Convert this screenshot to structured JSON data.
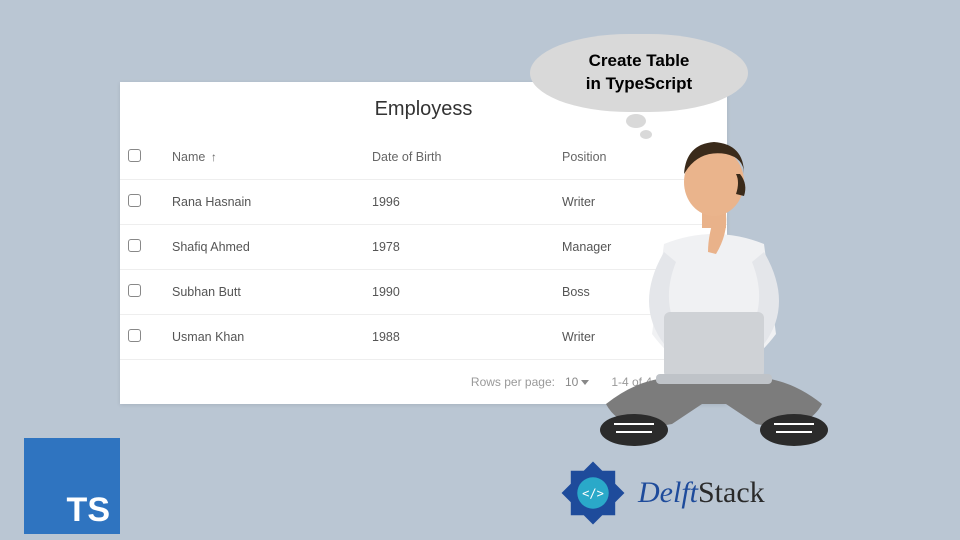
{
  "thought": {
    "line1": "Create Table",
    "line2": "in TypeScript"
  },
  "table": {
    "title": "Employess",
    "columns": {
      "name": "Name",
      "dob": "Date of Birth",
      "position": "Position"
    },
    "sort_dir": "asc",
    "rows": [
      {
        "name": "Rana Hasnain",
        "dob": "1996",
        "position": "Writer"
      },
      {
        "name": "Shafiq Ahmed",
        "dob": "1978",
        "position": "Manager"
      },
      {
        "name": "Subhan Butt",
        "dob": "1990",
        "position": "Boss"
      },
      {
        "name": "Usman Khan",
        "dob": "1988",
        "position": "Writer"
      }
    ],
    "pagination": {
      "rows_per_page_label": "Rows per page:",
      "page_size": "10",
      "range": "1-4 of 4"
    }
  },
  "ts_badge": "TS",
  "brand": {
    "name1": "Delft",
    "name2": "Stack"
  }
}
